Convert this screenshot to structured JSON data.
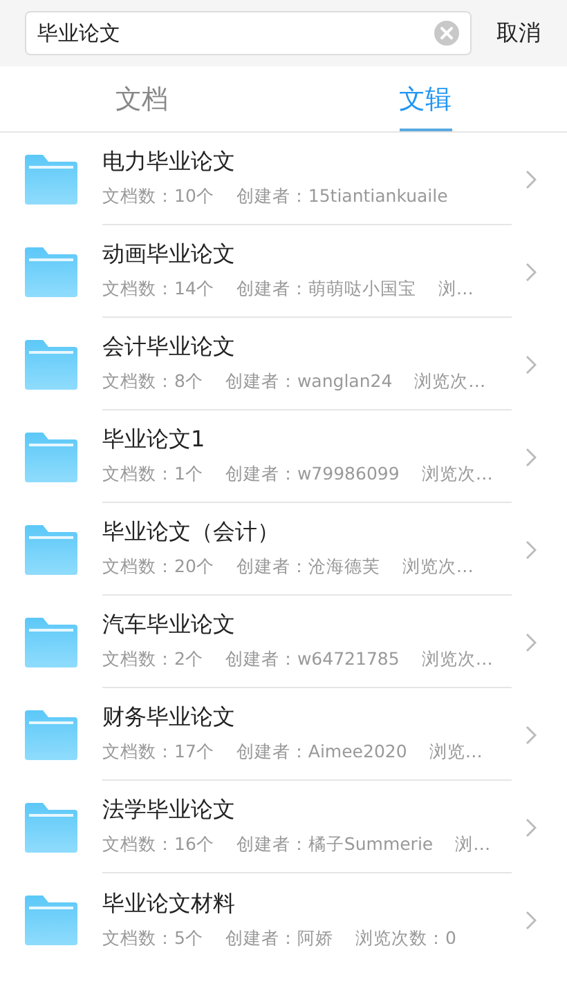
{
  "search": {
    "value": "毕业论文",
    "cancel": "取消"
  },
  "tabs": [
    {
      "label": "文档",
      "selected": false
    },
    {
      "label": "文辑",
      "selected": true
    }
  ],
  "albums": [
    {
      "title": "电力毕业论文",
      "docs": "文档数：10个",
      "creator": "创建者：15tiantiankuaile"
    },
    {
      "title": "动画毕业论文",
      "docs": "文档数：14个",
      "creator": "创建者：萌萌哒小国宝",
      "views": "浏…"
    },
    {
      "title": "会计毕业论文",
      "docs": "文档数：8个",
      "creator": "创建者：wanglan24",
      "views": "浏览次…"
    },
    {
      "title": "毕业论文1",
      "docs": "文档数：1个",
      "creator": "创建者：w79986099",
      "views": "浏览次…"
    },
    {
      "title": "毕业论文（会计）",
      "docs": "文档数：20个",
      "creator": "创建者：沧海德芙",
      "views": "浏览次…"
    },
    {
      "title": "汽车毕业论文",
      "docs": "文档数：2个",
      "creator": "创建者：w64721785",
      "views": "浏览次…"
    },
    {
      "title": "财务毕业论文",
      "docs": "文档数：17个",
      "creator": "创建者：Aimee2020",
      "views": "浏览…"
    },
    {
      "title": "法学毕业论文",
      "docs": "文档数：16个",
      "creator": "创建者：橘子Summerie",
      "views": "浏…"
    },
    {
      "title": "毕业论文材料",
      "docs": "文档数：5个",
      "creator": "创建者：阿娇",
      "views": "浏览次数：0"
    }
  ]
}
